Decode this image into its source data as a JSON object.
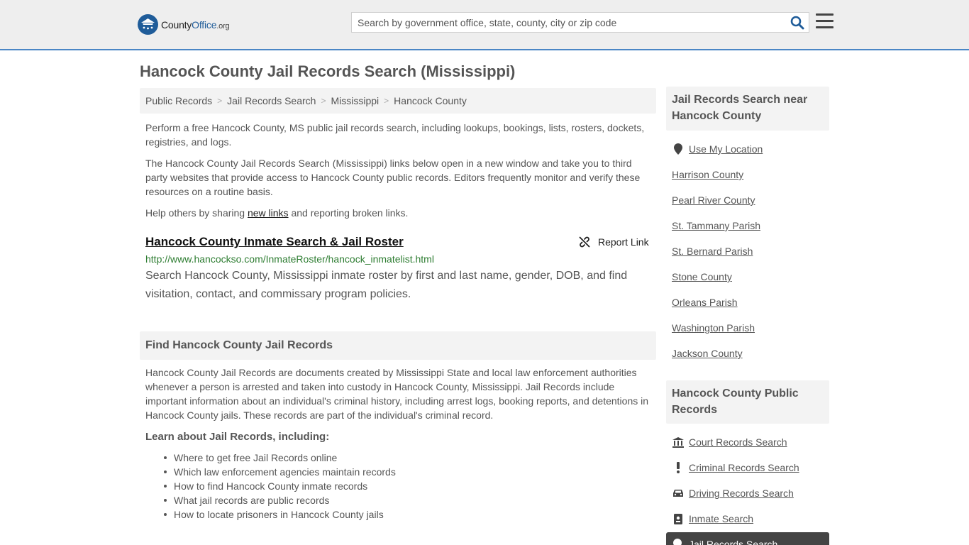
{
  "header": {
    "logo_text_main": "County",
    "logo_text_bold": "Office",
    "logo_text_org": ".org",
    "search_placeholder": "Search by government office, state, county, city or zip code"
  },
  "page": {
    "title": "Hancock County Jail Records Search (Mississippi)"
  },
  "breadcrumb": [
    "Public Records",
    "Jail Records Search",
    "Mississippi",
    "Hancock County"
  ],
  "intro": {
    "p1": "Perform a free Hancock County, MS public jail records search, including lookups, bookings, lists, rosters, dockets, registries, and logs.",
    "p2": "The Hancock County Jail Records Search (Mississippi) links below open in a new window and take you to third party websites that provide access to Hancock County public records. Editors frequently monitor and verify these resources on a routine basis.",
    "p3_before": "Help others by sharing ",
    "p3_link": "new links",
    "p3_after": " and reporting broken links."
  },
  "listing": {
    "title": "Hancock County Inmate Search & Jail Roster",
    "report_label": "Report Link",
    "url": "http://www.hancockso.com/InmateRoster/hancock_inmatelist.html",
    "description": "Search Hancock County, Mississippi inmate roster by first and last name, gender, DOB, and find visitation, contact, and commissary program policies."
  },
  "find_section": {
    "heading": "Find Hancock County Jail Records",
    "body": "Hancock County Jail Records are documents created by Mississippi State and local law enforcement authorities whenever a person is arrested and taken into custody in Hancock County, Mississippi. Jail Records include important information about an individual's criminal history, including arrest logs, booking reports, and detentions in Hancock County jails. These records are part of the individual's criminal record.",
    "learn_heading": "Learn about Jail Records, including:",
    "learn_items": [
      "Where to get free Jail Records online",
      "Which law enforcement agencies maintain records",
      "How to find Hancock County inmate records",
      "What jail records are public records",
      "How to locate prisoners in Hancock County jails"
    ]
  },
  "sidebar": {
    "nearby_heading": "Jail Records Search near Hancock County",
    "use_location": "Use My Location",
    "nearby": [
      "Harrison County",
      "Pearl River County",
      "St. Tammany Parish",
      "St. Bernard Parish",
      "Stone County",
      "Orleans Parish",
      "Washington Parish",
      "Jackson County"
    ],
    "public_heading": "Hancock County Public Records",
    "public_links": [
      "Court Records Search",
      "Criminal Records Search",
      "Driving Records Search",
      "Inmate Search",
      "Jail Records Search"
    ]
  }
}
